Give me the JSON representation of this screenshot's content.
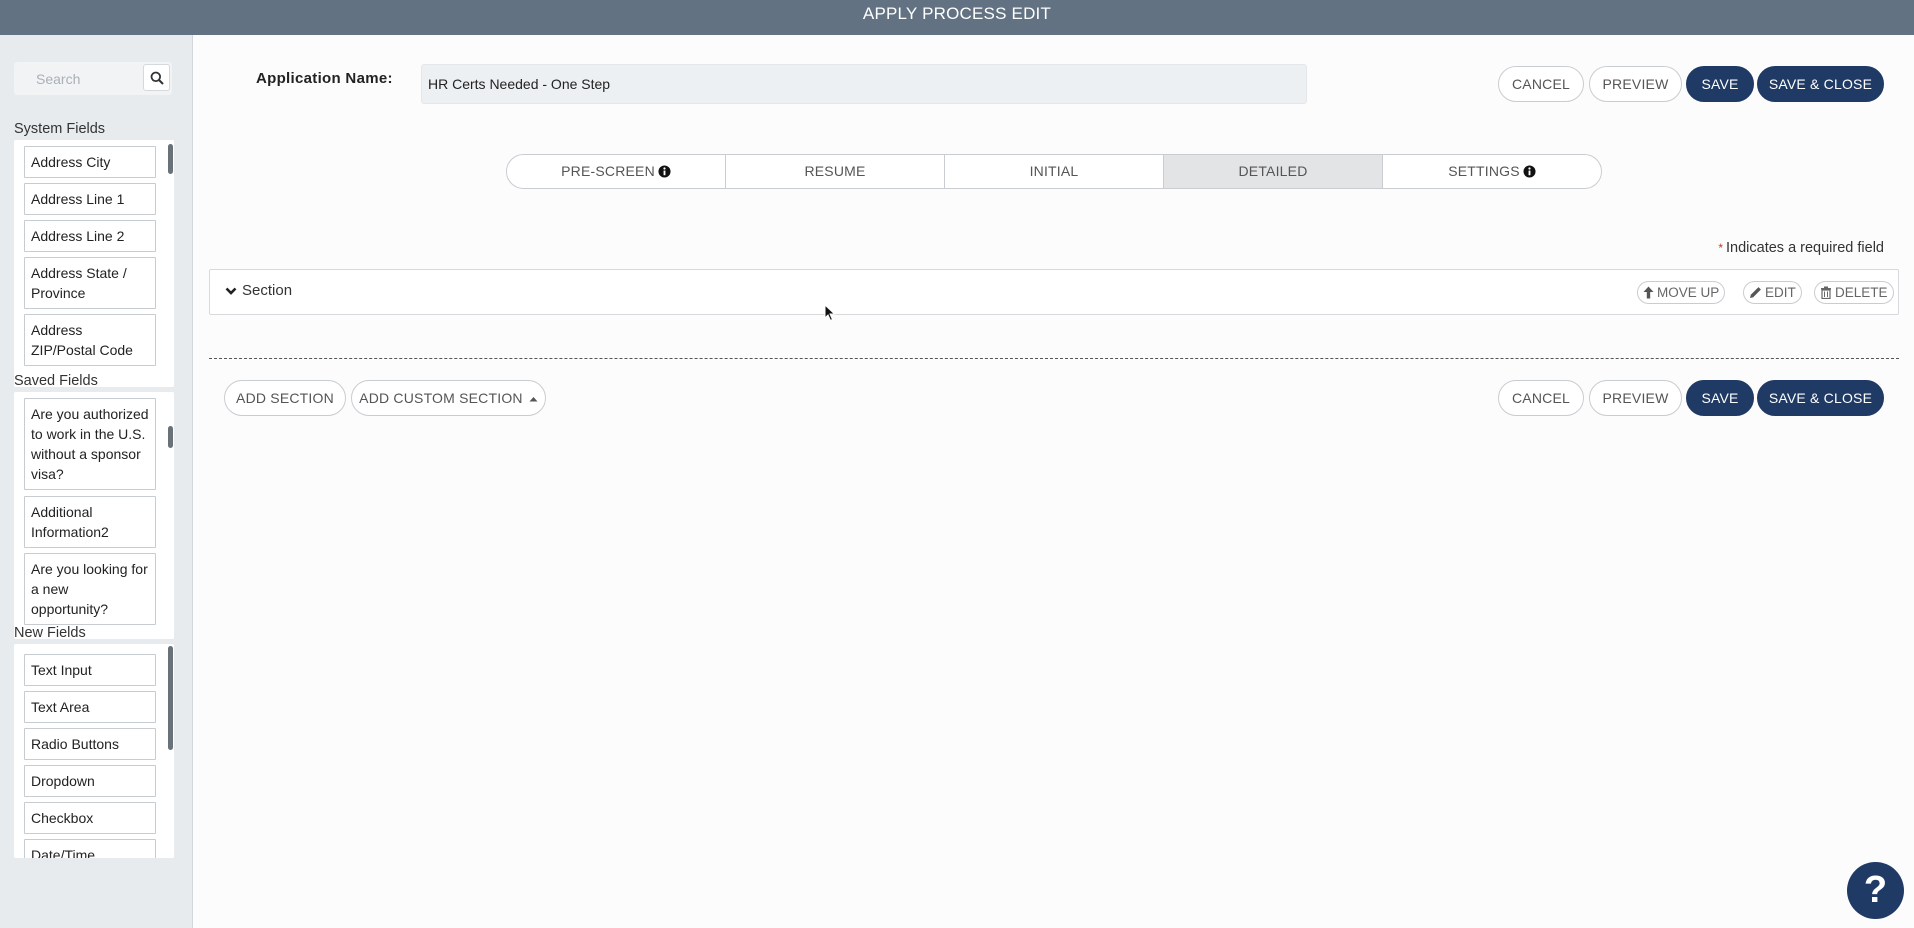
{
  "window": {
    "title": "APPLY PROCESS EDIT"
  },
  "sidebar": {
    "search": {
      "placeholder": "Search",
      "value": ""
    },
    "system_fields": {
      "title": "System Fields",
      "items": [
        "Address City",
        "Address Line 1",
        "Address Line 2",
        "Address State / Province",
        "Address ZIP/Postal Code"
      ]
    },
    "saved_fields": {
      "title": "Saved Fields",
      "items": [
        "Are you authorized to work in the U.S. without a sponsor visa?",
        "Additional Information2",
        "Are you looking for a new opportunity?"
      ]
    },
    "new_fields": {
      "title": "New Fields",
      "items": [
        "Text Input",
        "Text Area",
        "Radio Buttons",
        "Dropdown",
        "Checkbox",
        "Date/Time"
      ]
    }
  },
  "header": {
    "app_name_label": "Application Name:",
    "app_name_value": "HR Certs Needed - One Step",
    "cancel": "CANCEL",
    "preview": "PREVIEW",
    "save": "SAVE",
    "save_close": "SAVE & CLOSE"
  },
  "tabs": [
    {
      "label": "PRE-SCREEN",
      "info": true,
      "active": false
    },
    {
      "label": "RESUME",
      "info": false,
      "active": false
    },
    {
      "label": "INITIAL",
      "info": false,
      "active": false
    },
    {
      "label": "DETAILED",
      "info": false,
      "active": true
    },
    {
      "label": "SETTINGS",
      "info": true,
      "active": false
    }
  ],
  "required_note": {
    "star": "*",
    "text": "Indicates a required field"
  },
  "section": {
    "title": "Section",
    "move_up": "MOVE UP",
    "edit": "EDIT",
    "delete": "DELETE"
  },
  "footer": {
    "add_section": "ADD SECTION",
    "add_custom_section": "ADD CUSTOM SECTION",
    "cancel": "CANCEL",
    "preview": "PREVIEW",
    "save": "SAVE",
    "save_close": "SAVE & CLOSE"
  },
  "help": {
    "label": "?"
  },
  "colors": {
    "topbar": "#627282",
    "primary": "#1f3a64",
    "sidebar_bg": "#e8ebee",
    "active_tab": "#e3e4e5",
    "required_star": "#c0392b"
  }
}
